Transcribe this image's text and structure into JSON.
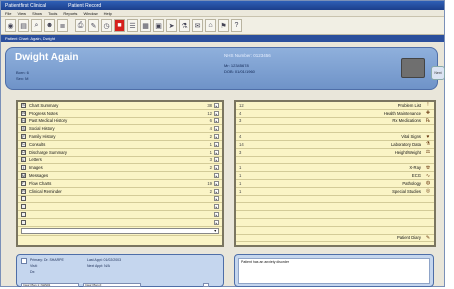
{
  "window": {
    "app_title": "Patientfirst Clinical",
    "title_suffix": "Patient Record"
  },
  "menu": [
    "File",
    "View",
    "Show",
    "Tools",
    "Reports",
    "Window",
    "Help"
  ],
  "toolbar": {
    "buttons": [
      {
        "icon": "stop-icon",
        "glyph": "◉"
      },
      {
        "icon": "record-icon",
        "glyph": "▤"
      },
      {
        "icon": "search-icon",
        "glyph": "⌕"
      },
      {
        "icon": "people-icon",
        "glyph": "☻"
      },
      {
        "icon": "list-icon",
        "glyph": "≣"
      },
      {
        "icon": "sep",
        "glyph": ""
      },
      {
        "icon": "print-icon",
        "glyph": "⎙"
      },
      {
        "icon": "pen-icon",
        "glyph": "✎"
      },
      {
        "icon": "clock-icon",
        "glyph": "◷"
      },
      {
        "icon": "alert-icon",
        "glyph": "■",
        "red": true
      },
      {
        "icon": "notes-icon",
        "glyph": "☰"
      },
      {
        "icon": "chart-icon",
        "glyph": "▦"
      },
      {
        "icon": "calendar-icon",
        "glyph": "▣"
      },
      {
        "icon": "pointer-icon",
        "glyph": "➤"
      },
      {
        "icon": "lab-icon",
        "glyph": "⚗"
      },
      {
        "icon": "letter-icon",
        "glyph": "✉"
      },
      {
        "icon": "home-icon",
        "glyph": "⌂"
      },
      {
        "icon": "flag-icon",
        "glyph": "⚑"
      },
      {
        "icon": "help-icon",
        "glyph": "?"
      }
    ]
  },
  "pathbar": {
    "text": "Patient Chart: Again, Dwight"
  },
  "patient": {
    "name": "Dwight Again",
    "line1": "Born: 6",
    "line2": "Sex: M",
    "nhs_label": "NHS Number: 0123456",
    "r1": "Mr: 12345678",
    "r2": "DOB: 01/01/1960"
  },
  "side_button": "Next",
  "left_list": [
    {
      "label": "Chart Summary",
      "icon": "S",
      "count": "38"
    },
    {
      "label": "Progress Notes",
      "icon": "N",
      "count": "12"
    },
    {
      "label": "Past Medical History",
      "icon": "H",
      "count": "6"
    },
    {
      "label": "Social History",
      "icon": "S",
      "count": "4"
    },
    {
      "label": "Family History",
      "icon": "F",
      "count": "2"
    },
    {
      "label": "Consults",
      "icon": "C",
      "count": "1"
    },
    {
      "label": "Discharge Summary",
      "icon": "D",
      "count": "1"
    },
    {
      "label": "Letters",
      "icon": "L",
      "count": "3"
    },
    {
      "label": "Images",
      "icon": "I",
      "count": "2"
    },
    {
      "label": "Messages",
      "icon": "M",
      "count": ""
    },
    {
      "label": "Flow Charts",
      "icon": "F",
      "count": "19"
    },
    {
      "label": "Clinical Reminder",
      "icon": "R",
      "count": "2"
    },
    {
      "label": "",
      "icon": "",
      "count": ""
    },
    {
      "label": "",
      "icon": "",
      "count": ""
    },
    {
      "label": "",
      "icon": "",
      "count": ""
    },
    {
      "label": "",
      "icon": "",
      "count": ""
    },
    {
      "label": "",
      "icon": "",
      "count": ""
    }
  ],
  "right_list": [
    {
      "label": "Problem List",
      "icon": "!",
      "count": "12"
    },
    {
      "label": "Health Maintenance",
      "icon": "✚",
      "count": "4"
    },
    {
      "label": "Rx Medications",
      "icon": "℞",
      "count": "3"
    },
    {
      "label": "",
      "icon": "",
      "count": ""
    },
    {
      "label": "Vital Signs",
      "icon": "♥",
      "count": "4"
    },
    {
      "label": "Laboratory Data",
      "icon": "⚗",
      "count": "14"
    },
    {
      "label": "Height/Weight",
      "icon": "⚖",
      "count": "3"
    },
    {
      "label": "",
      "icon": "",
      "count": ""
    },
    {
      "label": "X-Ray",
      "icon": "☢",
      "count": "1"
    },
    {
      "label": "ECG",
      "icon": "∿",
      "count": "1"
    },
    {
      "label": "Pathology",
      "icon": "◍",
      "count": "1"
    },
    {
      "label": "Special Studies",
      "icon": "◎",
      "count": "1"
    },
    {
      "label": "",
      "icon": "",
      "count": ""
    },
    {
      "label": "",
      "icon": "",
      "count": ""
    },
    {
      "label": "",
      "icon": "",
      "count": ""
    },
    {
      "label": "",
      "icon": "",
      "count": ""
    },
    {
      "label": "",
      "icon": "",
      "count": ""
    },
    {
      "label": "Patient Diary",
      "icon": "✎",
      "count": ""
    }
  ],
  "bottom_left": {
    "provider_line": "Primary: Dr. SHARPE",
    "visit1": "Visit:",
    "visit2": "Dx:",
    "last_appt": "Last Appt: 01/02/2003",
    "next_appt": "Next Appt: N/A",
    "field1": "Insur Plan 1: NHS01",
    "field2": "Insur Plan 2:"
  },
  "bottom_right": {
    "note": "Patient has an anxiety disorder"
  },
  "colors": {
    "accent": "#2b4f9c",
    "panel": "#faf4c6",
    "alert": "#d6201b"
  }
}
